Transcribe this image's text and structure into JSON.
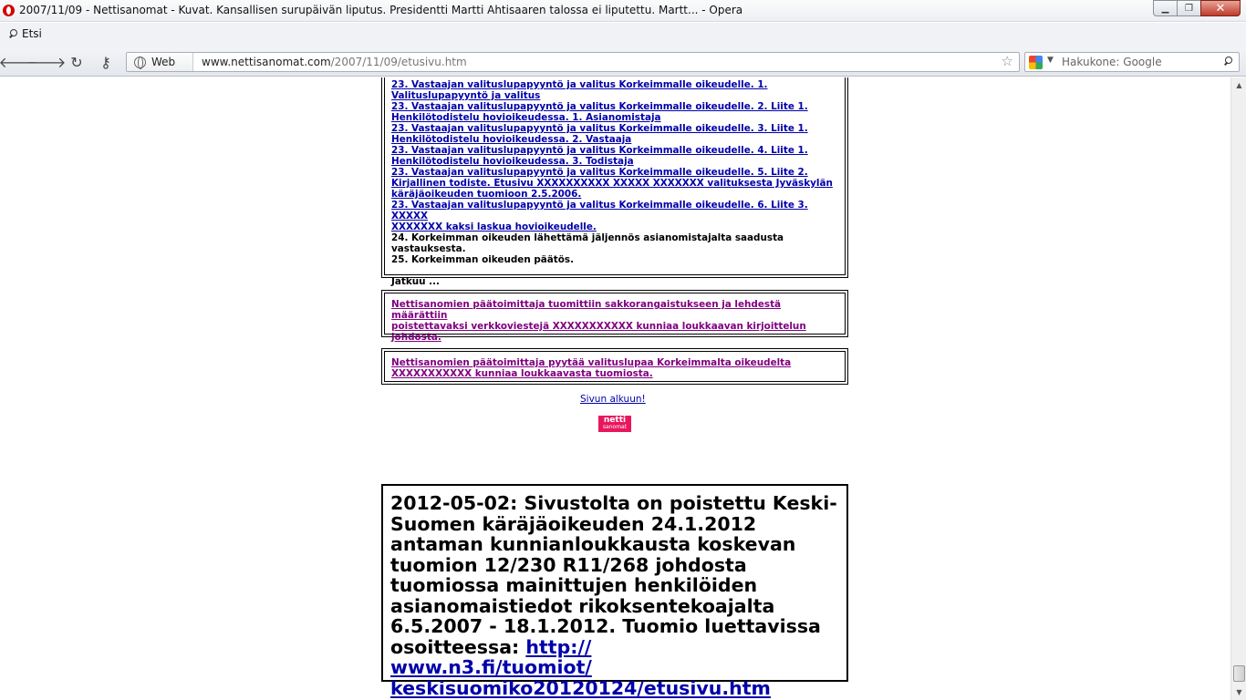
{
  "window": {
    "title": "2007/11/09 - Nettisanomat - Kuvat. Kansallisen surupäivän liputus. Presidentti Martti Ahtisaaren talossa ei liputettu. Martt... - Opera",
    "minimize": "▁",
    "restore": "❐",
    "close": "✕"
  },
  "menubar": {
    "search_label": "Etsi"
  },
  "toolbar": {
    "back": "🡐",
    "forward": "🡒",
    "reload": "↻",
    "wand": "⚷",
    "web_label": "Web",
    "url_host": "www.nettisanomat.com",
    "url_path": "/2007/11/09/etusivu.htm",
    "star": "☆",
    "search_placeholder": "Hakukone: Google",
    "search_caret": "▼"
  },
  "content": {
    "box1": {
      "links": [
        {
          "line1": "23. Vastaajan valituslupapyyntö ja valitus Korkeimmalle oikeudelle. 1.",
          "line2": "Valituslupapyyntö ja valitus"
        },
        {
          "line1": "23. Vastaajan valituslupapyyntö ja valitus Korkeimmalle oikeudelle. 2. Liite 1.",
          "line2": "Henkilötodistelu hovioikeudessa. 1. Asianomistaja"
        },
        {
          "line1": "23. Vastaajan valituslupapyyntö ja valitus Korkeimmalle oikeudelle. 3. Liite 1.",
          "line2": "Henkilötodistelu hovioikeudessa. 2. Vastaaja"
        },
        {
          "line1": "23. Vastaajan valituslupapyyntö ja valitus Korkeimmalle oikeudelle. 4. Liite 1.",
          "line2": "Henkilötodistelu hovioikeudessa. 3. Todistaja"
        }
      ],
      "link5": {
        "line1": "23. Vastaajan valituslupapyyntö ja valitus Korkeimmalle oikeudelle. 5. Liite 2.",
        "line2": "Kirjallinen todiste. Etusivu XXXXXXXXXX XXXXX XXXXXXX valituksesta Jyväskylän",
        "line3": "käräjäoikeuden tuomioon 2.5.2006."
      },
      "link6": {
        "line1": "23. Vastaajan valituslupapyyntö ja valitus Korkeimmalle oikeudelle. 6. Liite 3.",
        "line1b": "XXXXX",
        "line2": "XXXXXXX kaksi laskua hovioikeudelle."
      },
      "item24": {
        "line1": "24. Korkeimman oikeuden lähettämä jäljennös asianomistajalta saadusta",
        "line2": "vastauksesta."
      },
      "item25": "25. Korkeimman oikeuden päätös.",
      "continues": "Jatkuu ..."
    },
    "box2": {
      "line1": "Nettisanomien päätoimittaja tuomittiin sakkorangaistukseen ja lehdestä määrättiin",
      "line2": "poistettavaksi verkkoviestejä XXXXXXXXXXX kunniaa loukkaavan kirjoittelun",
      "line3": "johdosta."
    },
    "box3": {
      "line1": "Nettisanomien päätoimittaja pyytää valituslupaa Korkeimmalta oikeudelta",
      "line2": "XXXXXXXXXXX kunniaa loukkaavasta tuomiosta."
    },
    "top_link": "Sivun alkuun!",
    "logo": {
      "line1": "netti",
      "line2": "sanomat"
    },
    "notice": {
      "text": "2012-05-02: Sivustolta on poistettu Keski-Suomen käräjäoikeuden 24.1.2012 antaman kunnianloukkausta koskevan tuomion 12/230 R11/268 johdosta tuomiossa mainittujen henkilöiden asianomaistiedot rikoksentekoajalta 6.5.2007 - 18.1.2012. Tuomio luettavissa osoitteessa: ",
      "link_l1": "http://",
      "link_l2": "www.n3.fi/tuomiot/",
      "link_l3": "keskisuomiko20120124/etusivu.htm"
    }
  },
  "scrollbar": {
    "up": "▲",
    "down": "▼"
  },
  "colors": {
    "link": "#0000aa",
    "visited": "#800080",
    "logo_bg": "#e8175d",
    "close_btn": "#c0392b"
  }
}
